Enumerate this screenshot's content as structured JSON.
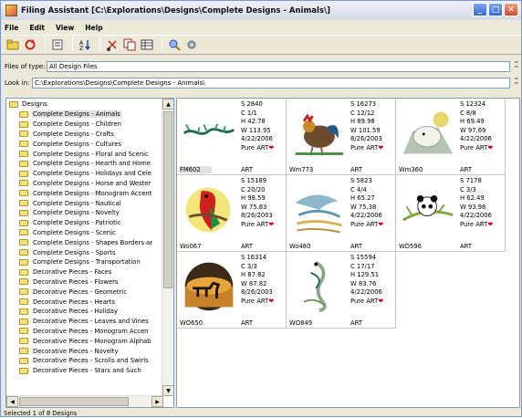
{
  "window": {
    "title": "Filing Assistant  [C:\\Explorations\\Designs\\Complete Designs - Animals\\]",
    "controls": [
      "minimize",
      "maximize",
      "close"
    ]
  },
  "menu": [
    "File",
    "Edit",
    "View",
    "Help"
  ],
  "toolbar": {
    "icons": [
      "open-folder-icon",
      "refresh-icon",
      "properties-icon",
      "sort-icon",
      "cut-icon",
      "copy-icon",
      "details-icon",
      "find-icon",
      "settings-icon"
    ]
  },
  "filters": {
    "files_of_type_label": "Files of type:",
    "files_of_type_value": "All Design Files",
    "look_in_label": "Look in:",
    "look_in_value": "C:\\Explorations\\Designs\\Complete Designs - Animals\\"
  },
  "tree": {
    "root": "Designs",
    "selected_index": 0,
    "items": [
      "Complete Designs - Animals",
      "Complete Designs - Children",
      "Complete Designs - Crafts",
      "Complete Designs - Cultures",
      "Complete Designs - Floral and Scenic",
      "Complete Designs - Hearth and Home",
      "Complete Designs - Holidays and Cele",
      "Complete Designs - Horse and Wester",
      "Complete Designs - Monogram Accent",
      "Complete Designs - Nautical",
      "Complete Designs - Novelty",
      "Complete Designs - Patriotic",
      "Complete Designs - Scenic",
      "Complete Designs - Shapes Borders ar",
      "Complete Designs - Sports",
      "Complete Designs - Transportation",
      "Decorative Pieces - Faces",
      "Decorative Pieces - Flowers",
      "Decorative Pieces - Geometric",
      "Decorative Pieces - Hearts",
      "Decorative Pieces - Holiday",
      "Decorative Pieces - Leaves and Vines",
      "Decorative Pieces - Monogram Accen",
      "Decorative Pieces - Monogram Alphab",
      "Decorative Pieces - Novelty",
      "Decorative Pieces - Scrolls and Swirls",
      "Decorative Pieces - Stars and Such"
    ]
  },
  "designs": [
    {
      "name": "FM602",
      "stitches": "S  2840",
      "colors": "C  1/1",
      "height": "H  42.78",
      "width": "W  113.95",
      "date": "4/22/2006",
      "pure": "Pure ART",
      "type": "ART",
      "thumb": "vine-icon",
      "selected": true
    },
    {
      "name": "Wm773",
      "stitches": "S  16273",
      "colors": "C  12/12",
      "height": "H  89.98",
      "width": "W  101.59",
      "date": "8/26/2003",
      "pure": "Pure ART",
      "type": "ART",
      "thumb": "rooster-icon",
      "selected": false
    },
    {
      "name": "Wm360",
      "stitches": "S  12324",
      "colors": "C  8/8",
      "height": "H  69.49",
      "width": "W  97.69",
      "date": "4/22/2006",
      "pure": "Pure ART",
      "type": "ART",
      "thumb": "polar-bear-icon",
      "selected": false
    },
    {
      "name": "Wo067",
      "stitches": "S  15189",
      "colors": "C  20/20",
      "height": "H  98.59",
      "width": "W  75.83",
      "date": "8/26/2003",
      "pure": "Pure ART",
      "type": "ART",
      "thumb": "parrot-icon",
      "selected": false
    },
    {
      "name": "Wo480",
      "stitches": "S  5823",
      "colors": "C  4/4",
      "height": "H  65.27",
      "width": "W  75.38",
      "date": "4/22/2006",
      "pure": "Pure ART",
      "type": "ART",
      "thumb": "dolphin-icon",
      "selected": false
    },
    {
      "name": "WD596",
      "stitches": "S  7178",
      "colors": "C  3/3",
      "height": "H  62.49",
      "width": "W  93.98",
      "date": "4/22/2006",
      "pure": "Pure ART",
      "type": "ART",
      "thumb": "panda-icon",
      "selected": false
    },
    {
      "name": "WO650",
      "stitches": "S  16314",
      "colors": "C  3/3",
      "height": "H  87.82",
      "width": "W  87.82",
      "date": "8/26/2003",
      "pure": "Pure ART",
      "type": "ART",
      "thumb": "lion-sunset-icon",
      "selected": false
    },
    {
      "name": "WO849",
      "stitches": "S  15594",
      "colors": "C  17/17",
      "height": "H  129.51",
      "width": "W  83.76",
      "date": "4/22/2006",
      "pure": "Pure ART",
      "type": "ART",
      "thumb": "lizard-icon",
      "selected": false
    }
  ],
  "status": "Selected 1 of 8 Designs"
}
